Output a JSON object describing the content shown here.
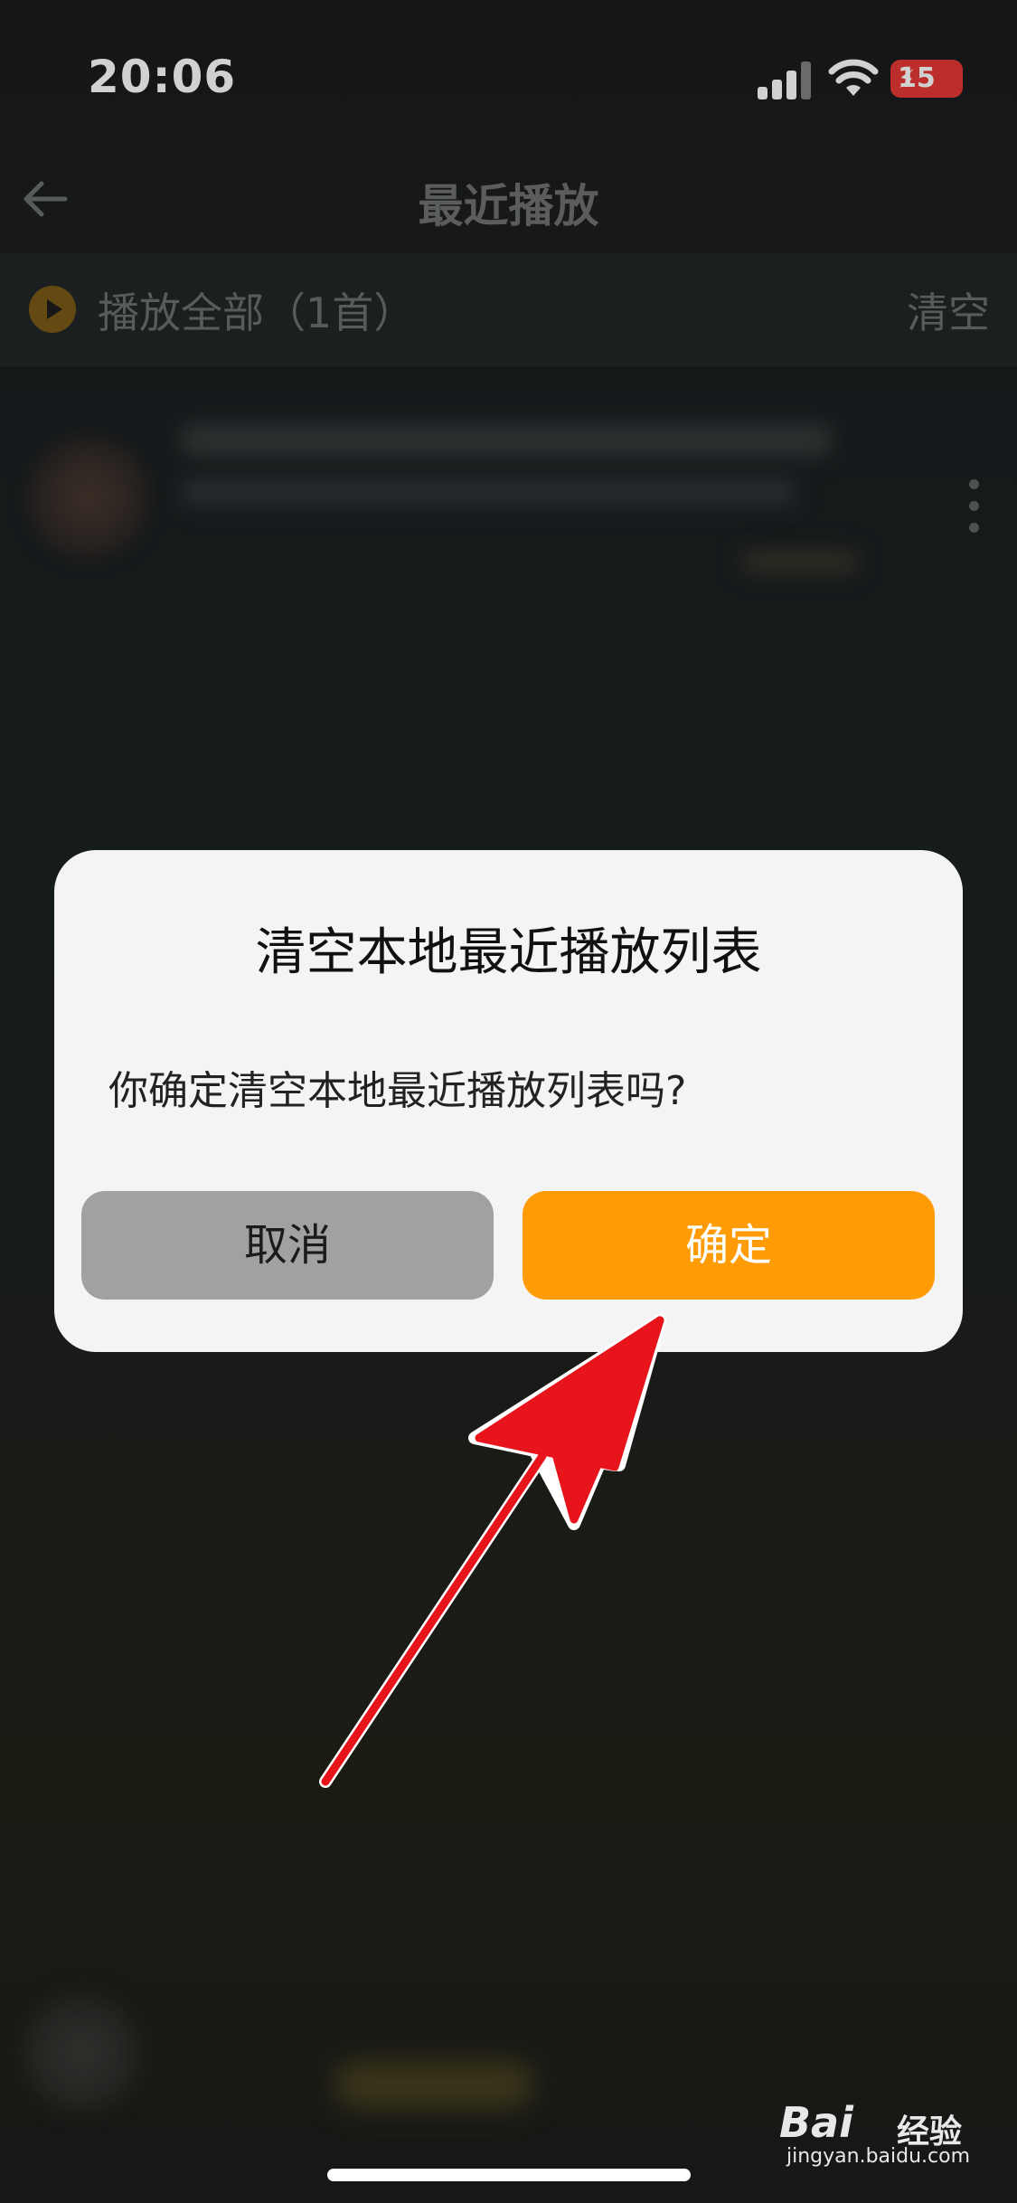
{
  "status_bar": {
    "time": "20:06",
    "battery_level": "15"
  },
  "navbar": {
    "title": "最近播放"
  },
  "playall": {
    "label": "播放全部（1首）",
    "clear_label": "清空"
  },
  "dialog": {
    "title": "清空本地最近播放列表",
    "message": "你确定清空本地最近播放列表吗?",
    "cancel_label": "取消",
    "confirm_label": "确定"
  },
  "watermark": {
    "brand": "Bai",
    "brand_cn": "经验",
    "url": "jingyan.baidu.com"
  },
  "colors": {
    "accent": "#ff9c05",
    "cancel_button": "#a1a1a1",
    "annotation_arrow": "#e8141c",
    "battery_low": "#e53935"
  },
  "icons": [
    "back-arrow-icon",
    "play-circle-icon",
    "more-vertical-icon",
    "signal-icon",
    "wifi-icon",
    "battery-icon"
  ]
}
